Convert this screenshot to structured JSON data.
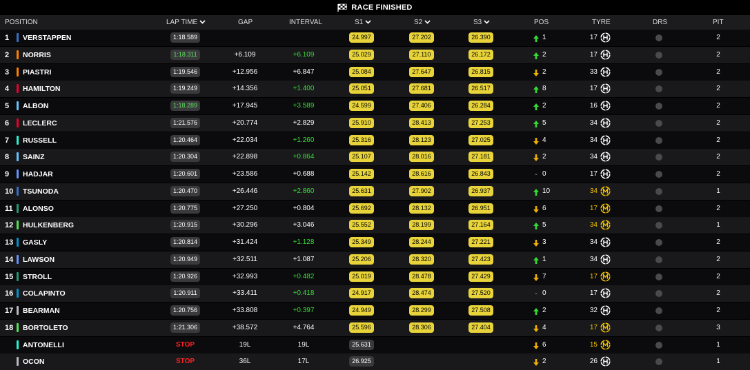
{
  "title": "RACE FINISHED",
  "headers": {
    "position": "POSITION",
    "lap_time": "LAP TIME",
    "gap": "GAP",
    "interval": "INTERVAL",
    "s1": "S1",
    "s2": "S2",
    "s3": "S3",
    "pos": "POS",
    "tyre": "TYRE",
    "drs": "DRS",
    "pit": "PIT"
  },
  "colors": {
    "green": "#33dd33",
    "yellow_sector": "#e8d43a",
    "stop_red": "#ff2222",
    "up_arrow": "#33dd33",
    "down_arrow": "#f0b000"
  },
  "rows": [
    {
      "pos": "1",
      "driver": "VERSTAPPEN",
      "team": "#3671C6",
      "lap": "1:18.589",
      "lap_best": false,
      "gap": "",
      "interval": "",
      "interval_green": false,
      "s1": "24.997",
      "s1c": "yellow",
      "s2": "27.202",
      "s2c": "yellow",
      "s3": "26.390",
      "s3c": "yellow",
      "dir": "up",
      "change": "1",
      "age": "17",
      "age_yellow": false,
      "tyre": "hard",
      "pit": "2"
    },
    {
      "pos": "2",
      "driver": "NORRIS",
      "team": "#FF8000",
      "lap": "1:18.311",
      "lap_best": true,
      "gap": "+6.109",
      "interval": "+6.109",
      "interval_green": true,
      "s1": "25.029",
      "s1c": "yellow",
      "s2": "27.110",
      "s2c": "yellow",
      "s3": "26.172",
      "s3c": "yellow",
      "dir": "up",
      "change": "2",
      "age": "17",
      "age_yellow": false,
      "tyre": "hard",
      "pit": "2"
    },
    {
      "pos": "3",
      "driver": "PIASTRI",
      "team": "#FF8000",
      "lap": "1:19.546",
      "lap_best": false,
      "gap": "+12.956",
      "interval": "+6.847",
      "interval_green": false,
      "s1": "25.084",
      "s1c": "yellow",
      "s2": "27.647",
      "s2c": "yellow",
      "s3": "26.815",
      "s3c": "yellow",
      "dir": "down",
      "change": "2",
      "age": "33",
      "age_yellow": false,
      "tyre": "hard",
      "pit": "2"
    },
    {
      "pos": "4",
      "driver": "HAMILTON",
      "team": "#E8002D",
      "lap": "1:19.249",
      "lap_best": false,
      "gap": "+14.356",
      "interval": "+1.400",
      "interval_green": true,
      "s1": "25.051",
      "s1c": "yellow",
      "s2": "27.681",
      "s2c": "yellow",
      "s3": "26.517",
      "s3c": "yellow",
      "dir": "up",
      "change": "8",
      "age": "17",
      "age_yellow": false,
      "tyre": "hard",
      "pit": "2"
    },
    {
      "pos": "5",
      "driver": "ALBON",
      "team": "#64C4FF",
      "lap": "1:18.289",
      "lap_best": true,
      "gap": "+17.945",
      "interval": "+3.589",
      "interval_green": true,
      "s1": "24.599",
      "s1c": "yellow",
      "s2": "27.406",
      "s2c": "yellow",
      "s3": "26.284",
      "s3c": "yellow",
      "dir": "up",
      "change": "2",
      "age": "16",
      "age_yellow": false,
      "tyre": "hard",
      "pit": "2"
    },
    {
      "pos": "6",
      "driver": "LECLERC",
      "team": "#E8002D",
      "lap": "1:21.576",
      "lap_best": false,
      "gap": "+20.774",
      "interval": "+2.829",
      "interval_green": false,
      "s1": "25.910",
      "s1c": "yellow",
      "s2": "28.413",
      "s2c": "yellow",
      "s3": "27.253",
      "s3c": "yellow",
      "dir": "up",
      "change": "5",
      "age": "34",
      "age_yellow": false,
      "tyre": "hard",
      "pit": "2"
    },
    {
      "pos": "7",
      "driver": "RUSSELL",
      "team": "#27F4D2",
      "lap": "1:20.464",
      "lap_best": false,
      "gap": "+22.034",
      "interval": "+1.260",
      "interval_green": true,
      "s1": "25.316",
      "s1c": "yellow",
      "s2": "28.123",
      "s2c": "yellow",
      "s3": "27.025",
      "s3c": "yellow",
      "dir": "down",
      "change": "4",
      "age": "34",
      "age_yellow": false,
      "tyre": "hard",
      "pit": "2"
    },
    {
      "pos": "8",
      "driver": "SAINZ",
      "team": "#64C4FF",
      "lap": "1:20.304",
      "lap_best": false,
      "gap": "+22.898",
      "interval": "+0.864",
      "interval_green": true,
      "s1": "25.107",
      "s1c": "yellow",
      "s2": "28.016",
      "s2c": "yellow",
      "s3": "27.181",
      "s3c": "yellow",
      "dir": "down",
      "change": "2",
      "age": "34",
      "age_yellow": false,
      "tyre": "hard",
      "pit": "2"
    },
    {
      "pos": "9",
      "driver": "HADJAR",
      "team": "#6692FF",
      "lap": "1:20.601",
      "lap_best": false,
      "gap": "+23.586",
      "interval": "+0.688",
      "interval_green": false,
      "s1": "25.142",
      "s1c": "yellow",
      "s2": "28.616",
      "s2c": "yellow",
      "s3": "26.843",
      "s3c": "yellow",
      "dir": "same",
      "change": "0",
      "age": "17",
      "age_yellow": false,
      "tyre": "hard",
      "pit": "2"
    },
    {
      "pos": "10",
      "driver": "TSUNODA",
      "team": "#3671C6",
      "lap": "1:20.470",
      "lap_best": false,
      "gap": "+26.446",
      "interval": "+2.860",
      "interval_green": true,
      "s1": "25.631",
      "s1c": "yellow",
      "s2": "27.902",
      "s2c": "yellow",
      "s3": "26.937",
      "s3c": "yellow",
      "dir": "up",
      "change": "10",
      "age": "34",
      "age_yellow": true,
      "tyre": "medium",
      "pit": "1"
    },
    {
      "pos": "11",
      "driver": "ALONSO",
      "team": "#229971",
      "lap": "1:20.775",
      "lap_best": false,
      "gap": "+27.250",
      "interval": "+0.804",
      "interval_green": false,
      "s1": "25.692",
      "s1c": "yellow",
      "s2": "28.132",
      "s2c": "yellow",
      "s3": "26.951",
      "s3c": "yellow",
      "dir": "down",
      "change": "6",
      "age": "17",
      "age_yellow": true,
      "tyre": "medium",
      "pit": "2"
    },
    {
      "pos": "12",
      "driver": "HULKENBERG",
      "team": "#52E252",
      "lap": "1:20.915",
      "lap_best": false,
      "gap": "+30.296",
      "interval": "+3.046",
      "interval_green": false,
      "s1": "25.552",
      "s1c": "yellow",
      "s2": "28.199",
      "s2c": "yellow",
      "s3": "27.164",
      "s3c": "yellow",
      "dir": "up",
      "change": "5",
      "age": "34",
      "age_yellow": true,
      "tyre": "medium",
      "pit": "1"
    },
    {
      "pos": "13",
      "driver": "GASLY",
      "team": "#0093CC",
      "lap": "1:20.814",
      "lap_best": false,
      "gap": "+31.424",
      "interval": "+1.128",
      "interval_green": true,
      "s1": "25.349",
      "s1c": "yellow",
      "s2": "28.244",
      "s2c": "yellow",
      "s3": "27.221",
      "s3c": "yellow",
      "dir": "down",
      "change": "3",
      "age": "34",
      "age_yellow": false,
      "tyre": "hard",
      "pit": "2"
    },
    {
      "pos": "14",
      "driver": "LAWSON",
      "team": "#6692FF",
      "lap": "1:20.949",
      "lap_best": false,
      "gap": "+32.511",
      "interval": "+1.087",
      "interval_green": false,
      "s1": "25.206",
      "s1c": "yellow",
      "s2": "28.320",
      "s2c": "yellow",
      "s3": "27.423",
      "s3c": "yellow",
      "dir": "up",
      "change": "1",
      "age": "34",
      "age_yellow": false,
      "tyre": "hard",
      "pit": "2"
    },
    {
      "pos": "15",
      "driver": "STROLL",
      "team": "#229971",
      "lap": "1:20.926",
      "lap_best": false,
      "gap": "+32.993",
      "interval": "+0.482",
      "interval_green": true,
      "s1": "25.019",
      "s1c": "yellow",
      "s2": "28.478",
      "s2c": "yellow",
      "s3": "27.429",
      "s3c": "yellow",
      "dir": "down",
      "change": "7",
      "age": "17",
      "age_yellow": true,
      "tyre": "medium",
      "pit": "2"
    },
    {
      "pos": "16",
      "driver": "COLAPINTO",
      "team": "#0093CC",
      "lap": "1:20.911",
      "lap_best": false,
      "gap": "+33.411",
      "interval": "+0.418",
      "interval_green": true,
      "s1": "24.917",
      "s1c": "yellow",
      "s2": "28.474",
      "s2c": "yellow",
      "s3": "27.520",
      "s3c": "yellow",
      "dir": "same",
      "change": "0",
      "age": "17",
      "age_yellow": false,
      "tyre": "hard",
      "pit": "2"
    },
    {
      "pos": "17",
      "driver": "BEARMAN",
      "team": "#B6BABD",
      "lap": "1:20.756",
      "lap_best": false,
      "gap": "+33.808",
      "interval": "+0.397",
      "interval_green": true,
      "s1": "24.949",
      "s1c": "yellow",
      "s2": "28.299",
      "s2c": "yellow",
      "s3": "27.508",
      "s3c": "yellow",
      "dir": "up",
      "change": "2",
      "age": "32",
      "age_yellow": false,
      "tyre": "hard",
      "pit": "2"
    },
    {
      "pos": "18",
      "driver": "BORTOLETO",
      "team": "#52E252",
      "lap": "1:21.306",
      "lap_best": false,
      "gap": "+38.572",
      "interval": "+4.764",
      "interval_green": false,
      "s1": "25.596",
      "s1c": "yellow",
      "s2": "28.306",
      "s2c": "yellow",
      "s3": "27.404",
      "s3c": "yellow",
      "dir": "down",
      "change": "4",
      "age": "17",
      "age_yellow": true,
      "tyre": "medium",
      "pit": "3"
    },
    {
      "pos": "",
      "driver": "ANTONELLI",
      "team": "#27F4D2",
      "lap": "STOP",
      "lap_best": false,
      "stop": true,
      "gap": "19L",
      "interval": "19L",
      "interval_green": false,
      "s1": "25.631",
      "s1c": "gray",
      "s2": "",
      "s2c": "",
      "s3": "",
      "s3c": "",
      "dir": "down",
      "change": "6",
      "age": "15",
      "age_yellow": true,
      "tyre": "medium",
      "pit": "1"
    },
    {
      "pos": "",
      "driver": "OCON",
      "team": "#B6BABD",
      "lap": "STOP",
      "lap_best": false,
      "stop": true,
      "gap": "36L",
      "interval": "17L",
      "interval_green": false,
      "s1": "26.925",
      "s1c": "gray",
      "s2": "",
      "s2c": "",
      "s3": "",
      "s3c": "",
      "dir": "down",
      "change": "2",
      "age": "26",
      "age_yellow": false,
      "tyre": "hard",
      "pit": "1"
    }
  ]
}
